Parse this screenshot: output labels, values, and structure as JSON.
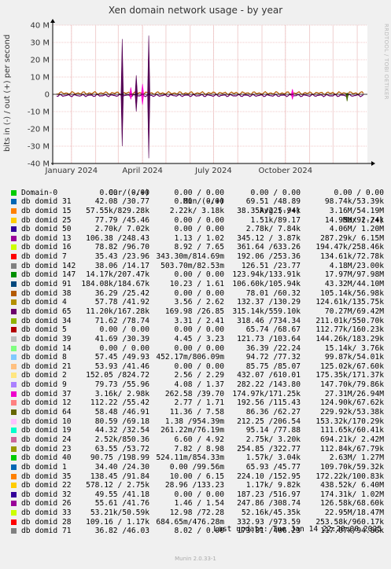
{
  "chart_data": {
    "type": "line",
    "title": "Xen domain network usage - by year",
    "ylabel": "bits in (-) / out (+) per second",
    "side_label": "RRDTOOL / TOBI OETIKER",
    "ylim": [
      -40000000,
      40000000
    ],
    "yticks": [
      "40 M",
      "30 M",
      "20 M",
      "10 M",
      "0",
      "-10 M",
      "-20 M",
      "-30 M",
      "-40 M"
    ],
    "ytick_values": [
      40000000,
      30000000,
      20000000,
      10000000,
      0,
      -10000000,
      -20000000,
      -30000000,
      -40000000
    ],
    "xticks": [
      "January 2024",
      "April 2024",
      "July 2024",
      "October 2024"
    ],
    "xtick_dates": [
      "2024-01-01",
      "2024-04-01",
      "2024-07-01",
      "2024-10-01"
    ],
    "xlim": [
      "2023-12-08",
      "2025-01-14"
    ],
    "grid": true,
    "spikes": [
      {
        "date": "2024-03-06",
        "out": 32000000,
        "in": -30000000,
        "color": "#550055"
      },
      {
        "date": "2024-03-24",
        "out": 11000000,
        "in": -10000000,
        "color": "#550055"
      },
      {
        "date": "2024-04-09",
        "out": 34000000,
        "in": -37000000,
        "color": "#550055"
      },
      {
        "date": "2024-04-01",
        "out": 6000000,
        "in": -6000000,
        "color": "#ff00cc"
      },
      {
        "date": "2024-03-17",
        "out": 4000000,
        "in": -3000000,
        "color": "#ff00cc"
      },
      {
        "date": "2024-10-10",
        "out": 3000000,
        "in": -3000000,
        "color": "#ff00cc"
      },
      {
        "date": "2024-12-19",
        "out": 800000,
        "in": -4000000,
        "color": "#446600"
      }
    ],
    "columns": {
      "cur": "Cur (-/+)",
      "min": "Min (-/+)",
      "avg": "Avg (-/+)",
      "max": "Max (-/+)"
    },
    "series": [
      {
        "name": "Domain-0",
        "color": "#00cc00",
        "cur": "0.00 / 0.00",
        "min": "0.00 / 0.00",
        "avg": "0.00 / 0.00",
        "max": "0.00 / 0.00"
      },
      {
        "name": "db domid 31",
        "color": "#0066b3",
        "cur": "42.08 /30.77",
        "min": "0.00 / 0.00",
        "avg": "69.51 /48.89",
        "max": "98.74k/53.39k"
      },
      {
        "name": "db domid 15",
        "color": "#ff8000",
        "cur": "57.55k/829.28k",
        "min": "2.22k/ 3.18k",
        "avg": "38.35k/225.94k",
        "max": "3.16M/54.19M"
      },
      {
        "name": "db domid 25",
        "color": "#ffcc00",
        "cur": "77.79 /45.46",
        "min": "0.00 / 0.00",
        "avg": "1.51k/89.17",
        "max": "14.95M/92.24k"
      },
      {
        "name": "db domid 50",
        "color": "#330099",
        "cur": "2.70k/ 7.02k",
        "min": "0.00 / 0.00",
        "avg": "2.78k/ 7.84k",
        "max": "4.06M/ 1.20M"
      },
      {
        "name": "db domid 13",
        "color": "#990099",
        "cur": "106.38 /248.43",
        "min": "1.13 / 1.02",
        "avg": "345.12 / 3.87k",
        "max": "287.29k/ 6.15M"
      },
      {
        "name": "db domid 16",
        "color": "#ccff00",
        "cur": "78.82 /96.70",
        "min": "8.92 / 7.65",
        "avg": "361.64 /633.26",
        "max": "194.47k/258.46k"
      },
      {
        "name": "db domid 7",
        "color": "#ff0000",
        "cur": "35.43 /23.96",
        "min": "343.30m/814.69m",
        "avg": "192.06 /253.36",
        "max": "134.61k/72.78k"
      },
      {
        "name": "db domid 142",
        "color": "#808080",
        "cur": "38.06 /14.17",
        "min": "503.70m/82.53m",
        "avg": "126.51 /23.77",
        "max": "4.18M/23.00k"
      },
      {
        "name": "db domid 147",
        "color": "#008f00",
        "cur": "14.17k/207.47k",
        "min": "0.00 / 0.00",
        "avg": "123.94k/133.91k",
        "max": "17.97M/97.98M"
      },
      {
        "name": "db domid 91",
        "color": "#00487d",
        "cur": "184.08k/184.67k",
        "min": "10.23 / 1.61",
        "avg": "106.60k/105.94k",
        "max": "43.32M/44.10M"
      },
      {
        "name": "db domid 38",
        "color": "#b35a00",
        "cur": "36.29 /25.42",
        "min": "0.00 / 0.00",
        "avg": "78.01 /60.32",
        "max": "105.14k/56.98k"
      },
      {
        "name": "db domid 4",
        "color": "#b38f00",
        "cur": "57.78 /41.92",
        "min": "3.56 / 2.62",
        "avg": "132.37 /130.29",
        "max": "124.61k/135.75k"
      },
      {
        "name": "db domid 65",
        "color": "#6b006b",
        "cur": "11.20k/167.28k",
        "min": "169.98 /26.85",
        "avg": "315.14k/559.10k",
        "max": "70.27M/69.42M"
      },
      {
        "name": "db domid 34",
        "color": "#8fb300",
        "cur": "71.62 /78.74",
        "min": "3.31 / 2.41",
        "avg": "318.46 /734.34",
        "max": "211.01k/550.70k"
      },
      {
        "name": "db domid 5",
        "color": "#b30000",
        "cur": "0.00 / 0.00",
        "min": "0.00 / 0.00",
        "avg": "65.74 /68.67",
        "max": "112.77k/160.23k"
      },
      {
        "name": "db domid 39",
        "color": "#bebebe",
        "cur": "41.69 /30.39",
        "min": "4.45 / 3.23",
        "avg": "121.73 /103.64",
        "max": "144.26k/183.29k"
      },
      {
        "name": "db domid 14",
        "color": "#80ff80",
        "cur": "0.00 / 0.00",
        "min": "0.00 / 0.00",
        "avg": "36.39 /22.24",
        "max": "15.14k/ 3.76k"
      },
      {
        "name": "db domid 8",
        "color": "#80c9ff",
        "cur": "57.45 /49.93",
        "min": "452.17m/806.09m",
        "avg": "94.72 /77.32",
        "max": "99.87k/54.01k"
      },
      {
        "name": "db domid 21",
        "color": "#ffc080",
        "cur": "53.93 /41.46",
        "min": "0.00 / 0.00",
        "avg": "85.75 /85.07",
        "max": "125.02k/67.60k"
      },
      {
        "name": "db domid 2",
        "color": "#ffe680",
        "cur": "152.05 /824.72",
        "min": "2.56 / 2.29",
        "avg": "432.07 /610.01",
        "max": "175.35k/171.37k"
      },
      {
        "name": "db domid 9",
        "color": "#aa80ff",
        "cur": "79.73 /55.96",
        "min": "4.08 / 1.37",
        "avg": "282.22 /143.80",
        "max": "147.70k/79.86k"
      },
      {
        "name": "db domid 37",
        "color": "#ee00cc",
        "cur": "3.16k/ 2.98k",
        "min": "262.58 /39.70",
        "avg": "174.97k/171.25k",
        "max": "27.31M/26.94M"
      },
      {
        "name": "db domid 12",
        "color": "#ff8080",
        "cur": "112.22 /55.42",
        "min": "2.77 / 1.71",
        "avg": "192.56 /115.43",
        "max": "124.90k/67.62k"
      },
      {
        "name": "db domid 64",
        "color": "#666600",
        "cur": "58.48 /46.91",
        "min": "11.36 / 7.58",
        "avg": "86.36 /62.27",
        "max": "229.92k/53.38k"
      },
      {
        "name": "db domid 10",
        "color": "#ffbfff",
        "cur": "80.59 /69.18",
        "min": "1.38 /954.39m",
        "avg": "212.25 /206.54",
        "max": "153.32k/170.29k"
      },
      {
        "name": "db domid 19",
        "color": "#00ffcc",
        "cur": "44.32 /32.54",
        "min": "261.22m/76.19m",
        "avg": "95.14 /77.88",
        "max": "111.65k/60.41k"
      },
      {
        "name": "db domid 24",
        "color": "#cc6699",
        "cur": "2.52k/850.36",
        "min": "6.60 / 4.92",
        "avg": "2.75k/ 3.20k",
        "max": "694.21k/ 2.42M"
      },
      {
        "name": "db domid 23",
        "color": "#999900",
        "cur": "63.55 /53.72",
        "min": "7.82 / 8.98",
        "avg": "254.85 /322.77",
        "max": "112.84k/67.79k"
      },
      {
        "name": "db domid 40",
        "color": "#00cc00",
        "cur": "90.75 /198.99",
        "min": "524.11m/854.33m",
        "avg": "1.57k/ 3.04k",
        "max": "2.63M/ 1.27M"
      },
      {
        "name": "db domid 1",
        "color": "#0066b3",
        "cur": "34.40 /24.30",
        "min": "0.00 /99.56m",
        "avg": "65.93 /45.77",
        "max": "109.70k/59.32k"
      },
      {
        "name": "db domid 35",
        "color": "#ff8000",
        "cur": "138.45 /91.84",
        "min": "10.00 / 6.15",
        "avg": "224.10 /152.95",
        "max": "172.22k/100.83k"
      },
      {
        "name": "db domid 22",
        "color": "#ffcc00",
        "cur": "578.12 / 2.75k",
        "min": "28.96 /133.23",
        "avg": "1.17k/ 9.82k",
        "max": "438.52k/ 6.40M"
      },
      {
        "name": "db domid 32",
        "color": "#330099",
        "cur": "49.55 /41.18",
        "min": "0.00 / 0.00",
        "avg": "187.23 /516.97",
        "max": "174.31k/ 1.02M"
      },
      {
        "name": "db domid 26",
        "color": "#990099",
        "cur": "55.61 /41.76",
        "min": "1.46 / 1.54",
        "avg": "247.86 /308.74",
        "max": "126.58k/68.60k"
      },
      {
        "name": "db domid 33",
        "color": "#ccff00",
        "cur": "53.21k/50.59k",
        "min": "12.98 /72.28",
        "avg": "52.16k/45.35k",
        "max": "22.95M/18.47M"
      },
      {
        "name": "db domid 28",
        "color": "#ff0000",
        "cur": "109.16 / 1.17k",
        "min": "684.65m/476.28m",
        "avg": "332.93 /973.59",
        "max": "253.58k/960.17k"
      },
      {
        "name": "db domid 71",
        "color": "#808080",
        "cur": "36.82 /46.03",
        "min": "8.02 / 0.00",
        "avg": "173.81 /406.23",
        "max": "117.07k/94.86k"
      }
    ],
    "last_update": "Last update:  Tue Jan 14 22:20:00 2025",
    "footer": "Munin 2.0.33-1"
  }
}
